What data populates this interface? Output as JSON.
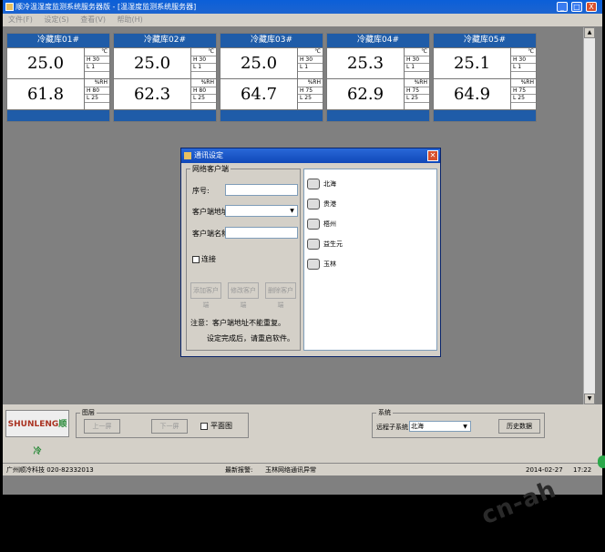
{
  "window": {
    "title": "顺冷温湿度监测系统服务器版 - [温湿度监测系统服务器]",
    "buttons": [
      "_",
      "□",
      "X"
    ]
  },
  "menu": {
    "items": [
      "文件(F)",
      "设定(S)",
      "查看(V)",
      "帮助(H)"
    ]
  },
  "panels": [
    {
      "name": "冷藏库01#",
      "temp": "25.0",
      "temp_unit": "℃",
      "temp_h": "H 30",
      "temp_l": "L 1",
      "hum": "61.8",
      "hum_unit": "%RH",
      "hum_h": "H 80",
      "hum_l": "L 25"
    },
    {
      "name": "冷藏库02#",
      "temp": "25.0",
      "temp_unit": "℃",
      "temp_h": "H 30",
      "temp_l": "L 1",
      "hum": "62.3",
      "hum_unit": "%RH",
      "hum_h": "H 80",
      "hum_l": "L 25"
    },
    {
      "name": "冷藏库03#",
      "temp": "25.0",
      "temp_unit": "℃",
      "temp_h": "H 30",
      "temp_l": "L 1",
      "hum": "64.7",
      "hum_unit": "%RH",
      "hum_h": "H 75",
      "hum_l": "L 25"
    },
    {
      "name": "冷藏库04#",
      "temp": "25.3",
      "temp_unit": "℃",
      "temp_h": "H 30",
      "temp_l": "L 1",
      "hum": "62.9",
      "hum_unit": "%RH",
      "hum_h": "H 75",
      "hum_l": "L 25"
    },
    {
      "name": "冷藏库05#",
      "temp": "25.1",
      "temp_unit": "℃",
      "temp_h": "H 30",
      "temp_l": "L 1",
      "hum": "64.9",
      "hum_unit": "%RH",
      "hum_h": "H 75",
      "hum_l": "L 25"
    }
  ],
  "dialog": {
    "title": "通讯设定",
    "group": "网络客户端",
    "seq_label": "序号:",
    "addr_label": "客户端地址:",
    "name_label": "客户端名称:",
    "connect_label": "连接",
    "btn_add": "添加客户端",
    "btn_modify": "修改客户端",
    "btn_delete": "删除客户端",
    "note1": "注意：客户端地址不能重复。",
    "note2": "设定完成后，请重启软件。",
    "clients": [
      "北海",
      "贵港",
      "梧州",
      "益生元",
      "玉林"
    ]
  },
  "bottom": {
    "logo_a": "SHUNLENG",
    "logo_b": "顺冷",
    "view_label": "图层",
    "prev": "上一屏",
    "next": "下一屏",
    "plan_label": "平面图",
    "system_label": "系统",
    "remote_label": "远程子系统",
    "remote_value": "北海",
    "history": "历史数据"
  },
  "status": {
    "company": "广州顺冷科技  020-82332013",
    "alarm_label": "最新报警:",
    "alarm_text": "玉林网络通讯异常",
    "date": "2014-02-27",
    "time": "17:22"
  },
  "watermark": "cn-ah"
}
